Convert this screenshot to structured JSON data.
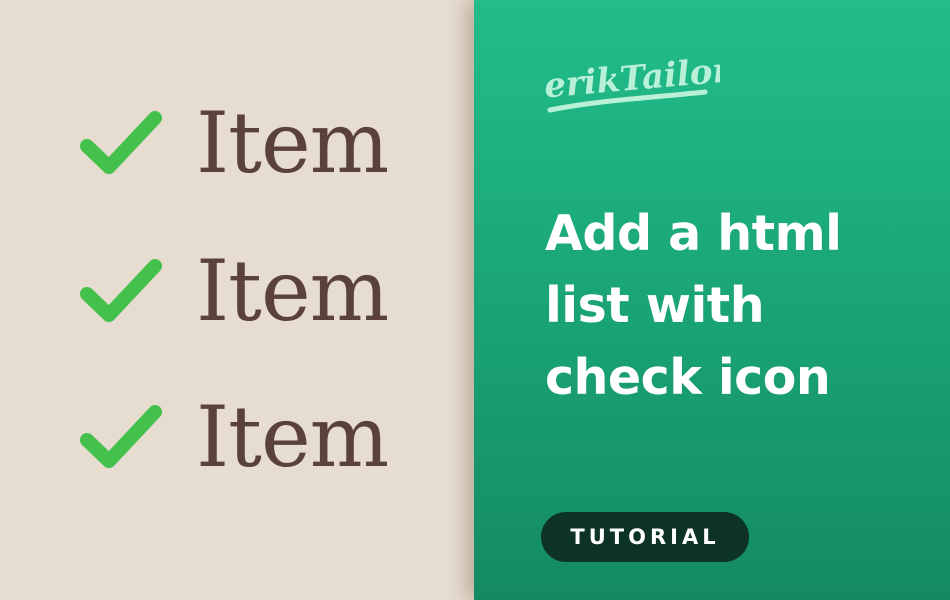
{
  "colors": {
    "left_background": "#e6dcd0",
    "right_gradient_top": "#22bd8b",
    "right_gradient_bottom": "#148a62",
    "check_green": "#44c14c",
    "item_text": "#5b413b",
    "headline_text": "#ffffff",
    "logo_mint": "#b9f0d8",
    "badge_background": "#0c3326"
  },
  "list": {
    "items": [
      {
        "icon": "check-icon",
        "label": "Item"
      },
      {
        "icon": "check-icon",
        "label": "Item"
      },
      {
        "icon": "check-icon",
        "label": "Item"
      }
    ]
  },
  "brand": {
    "logo_text": "erikTailor"
  },
  "headline": "Add a html list with check icon",
  "badge": {
    "label": "TUTORIAL"
  }
}
